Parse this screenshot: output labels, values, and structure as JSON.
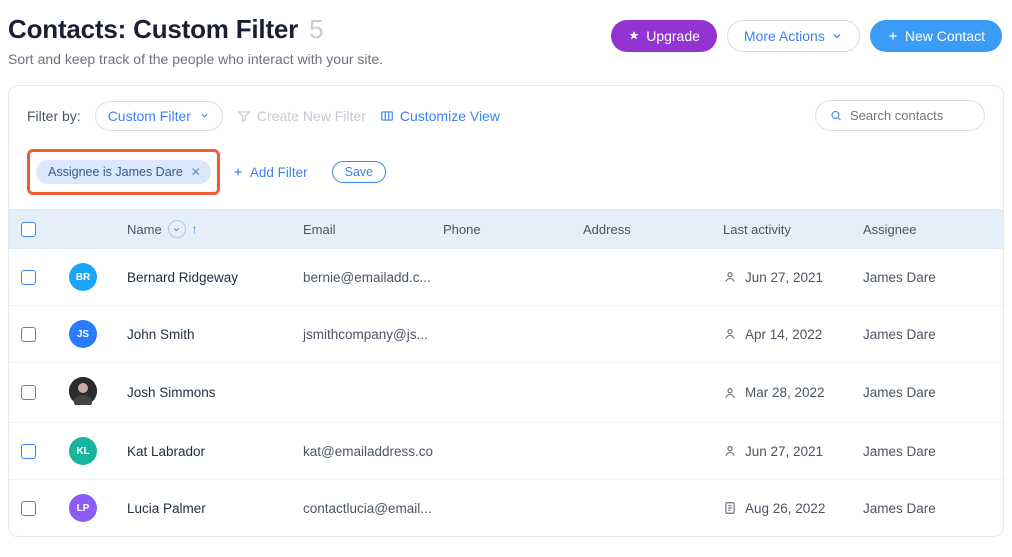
{
  "header": {
    "title_prefix": "Contacts: ",
    "title_filter": "Custom Filter",
    "count": "5",
    "subtitle": "Sort and keep track of the people who interact with your site.",
    "upgrade_label": "Upgrade",
    "more_label": "More Actions",
    "new_label": "New Contact"
  },
  "toolbar": {
    "filter_by_label": "Filter by:",
    "filter_selected": "Custom Filter",
    "create_filter_label": "Create New Filter",
    "customize_label": "Customize View",
    "search_placeholder": "Search contacts"
  },
  "filters": {
    "chip_label": "Assignee is James Dare",
    "add_label": "Add Filter",
    "save_label": "Save"
  },
  "columns": {
    "name": "Name",
    "email": "Email",
    "phone": "Phone",
    "address": "Address",
    "activity": "Last activity",
    "assignee": "Assignee"
  },
  "rows": [
    {
      "initials": "BR",
      "avatar_color": "#1aa3ff",
      "avatar_img": false,
      "name": "Bernard Ridgeway",
      "email": "bernie@emailadd.c...",
      "phone": "",
      "address": "",
      "activity_icon": "person",
      "activity": "Jun 27, 2021",
      "assignee": "James Dare"
    },
    {
      "initials": "JS",
      "avatar_color": "#277cff",
      "avatar_img": false,
      "name": "John Smith",
      "email": "jsmithcompany@js...",
      "phone": "",
      "address": "",
      "activity_icon": "person",
      "activity": "Apr 14, 2022",
      "assignee": "James Dare"
    },
    {
      "initials": "",
      "avatar_color": "#333333",
      "avatar_img": true,
      "name": "Josh Simmons",
      "email": "",
      "phone": "",
      "address": "",
      "activity_icon": "person",
      "activity": "Mar 28, 2022",
      "assignee": "James Dare"
    },
    {
      "initials": "KL",
      "avatar_color": "#17b59b",
      "avatar_img": false,
      "name": "Kat Labrador",
      "email": "kat@emailaddress.co",
      "phone": "",
      "address": "",
      "activity_icon": "person",
      "activity": "Jun 27, 2021",
      "assignee": "James Dare"
    },
    {
      "initials": "LP",
      "avatar_color": "#8b5cf6",
      "avatar_img": false,
      "name": "Lucia Palmer",
      "email": "contactlucia@email...",
      "phone": "",
      "address": "",
      "activity_icon": "form",
      "activity": "Aug 26, 2022",
      "assignee": "James Dare"
    }
  ]
}
